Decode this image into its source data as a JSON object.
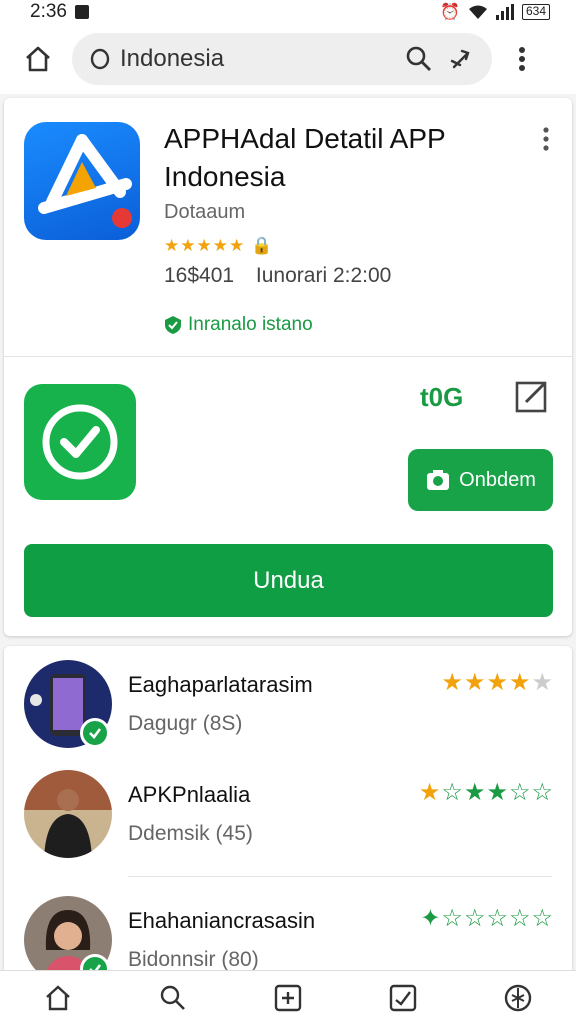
{
  "status_bar": {
    "time": "2:36",
    "battery": "634"
  },
  "search": {
    "query": "Indonesia"
  },
  "app": {
    "title": "APPHAdal Detatil APP Indonesia",
    "developer": "Dotaaum",
    "rating_stars": "★★★★★",
    "downloads": "16$401",
    "updated": "Iunorari 2:2:00",
    "verified_label": "Inranalo istano"
  },
  "app2": {
    "price": "t0G",
    "small_button_label": "Onbdem",
    "install_label": "Undua"
  },
  "reviews": [
    {
      "name": "Eaghaparlatarasim",
      "subtitle": "Dagugr (8S)",
      "rating_gold": "★★★★",
      "rating_grey": "★"
    },
    {
      "name": "APKPnlaalia",
      "subtitle": "Ddemsik (45)",
      "rating_gold": "★",
      "rating_mixed": "☆★★☆☆"
    },
    {
      "name": "Ehahaniancrasasin",
      "subtitle": "Bidonnsir (80)",
      "rating_green": "✦☆☆☆☆☆"
    }
  ],
  "colors": {
    "accent_green": "#0f9e44",
    "star_gold": "#f2a20c",
    "app_blue": "#1a8cff"
  },
  "icons": [
    "home-icon",
    "search-icon",
    "share-icon",
    "more-vert-icon",
    "edit-icon",
    "add-icon",
    "chart-icon",
    "settings-icon"
  ]
}
